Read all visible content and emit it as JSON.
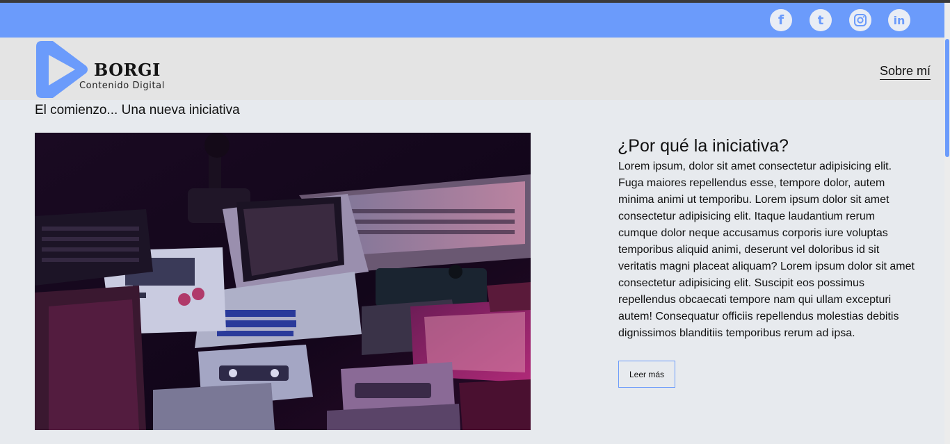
{
  "social": {
    "icons": [
      "facebook-icon",
      "tumblr-icon",
      "instagram-icon",
      "linkedin-icon"
    ],
    "facebook_glyph": "f",
    "tumblr_glyph": "t",
    "linkedin_glyph": "in"
  },
  "header": {
    "logo_title": "BORGI",
    "logo_subtitle": "Contenido Digital",
    "nav_about": "Sobre mí"
  },
  "main": {
    "page_title": "El comienzo... Una nueva iniciativa",
    "article_heading": "¿Por qué la iniciativa?",
    "article_body": "Lorem ipsum, dolor sit amet consectetur adipisicing elit. Fuga maiores repellendus esse, tempore dolor, autem minima animi ut temporibu. Lorem ipsum dolor sit amet consectetur adipisicing elit. Itaque laudantium rerum cumque dolor neque accusamus corporis iure voluptas temporibus aliquid animi, deserunt vel doloribus id sit veritatis magni placeat aliquam? Lorem ipsum dolor sit amet consectetur adipisicing elit. Suscipit eos possimus repellendus obcaecati tempore nam qui ullam excepturi autem! Consequatur officiis repellendus molestias debitis dignissimos blanditiis temporibus rerum ad ipsa.",
    "read_more_label": "Leer más"
  },
  "colors": {
    "accent": "#6b9bfb",
    "header_bg": "#e4e4e4",
    "page_bg": "#e7eaee"
  }
}
